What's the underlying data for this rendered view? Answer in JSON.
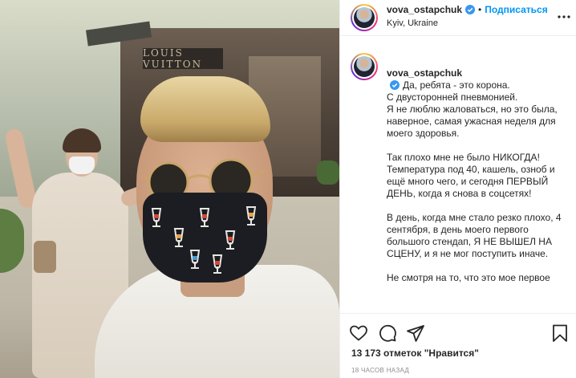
{
  "post": {
    "author": {
      "username": "vova_ostapchuk",
      "verified": true,
      "follow_label": "Подписаться",
      "separator": "•",
      "location": "Kyiv, Ukraine"
    },
    "photo": {
      "store_sign": "LOUIS VUITTON"
    },
    "caption": {
      "username": "vova_ostapchuk",
      "paragraphs": [
        "Да, ребята - это корона.\nС двусторонней пневмонией.\nЯ не люблю жаловаться, но это была, наверное, самая ужасная неделя для моего здоровья.",
        "Так плохо мне не было НИКОГДА!\nТемпература под 40, кашель, озноб и ещё много чего, и сегодня ПЕРВЫЙ ДЕНЬ, когда я снова в соцсетях!",
        "В день, когда мне стало резко плохо, 4 сентября, в день моего первого большого стендап, Я НЕ ВЫШЕЛ НА СЦЕНУ, и я не мог поступить иначе.",
        "Не смотря на то, что это мое первое"
      ]
    },
    "likes_text": "13 173 отметок \"Нравится\"",
    "time_ago": "18 ЧАСОВ НАЗАД",
    "icons": [
      "heart-icon",
      "comment-icon",
      "share-icon",
      "bookmark-icon",
      "more-icon"
    ],
    "colors": {
      "follow": "#0095f6",
      "verified": "#3897f0",
      "text": "#262626",
      "muted": "#8e8e8e"
    }
  }
}
